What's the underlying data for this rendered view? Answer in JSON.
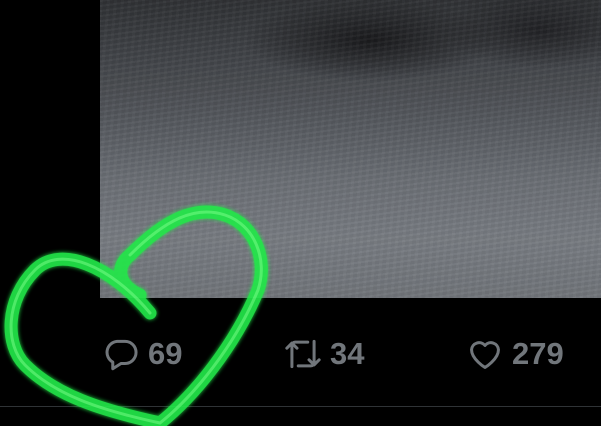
{
  "tweet_actions": {
    "reply": {
      "icon": "reply-icon",
      "count": "69"
    },
    "retweet": {
      "icon": "retweet-icon",
      "count": "34"
    },
    "like": {
      "icon": "heart-icon",
      "count": "279"
    }
  },
  "colors": {
    "background": "#000000",
    "action_gray": "#71767b",
    "doodle_green": "#22e84a"
  }
}
